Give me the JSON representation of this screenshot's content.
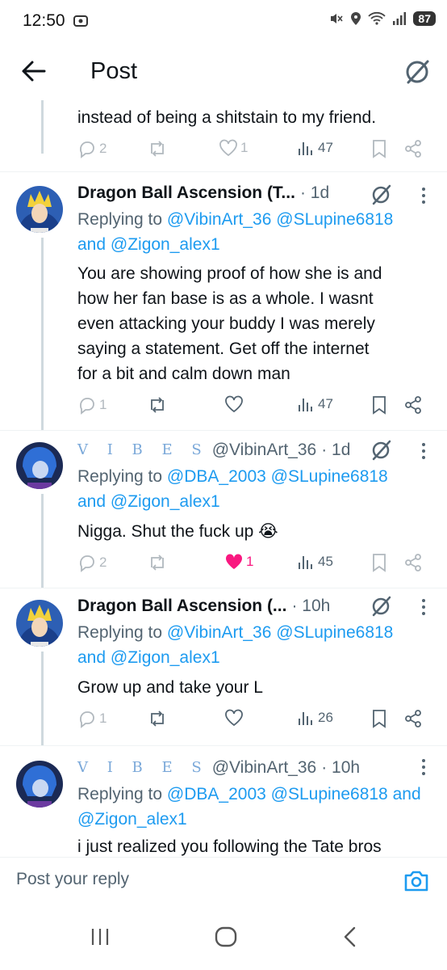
{
  "status": {
    "time": "12:50",
    "battery": "87"
  },
  "header": {
    "title": "Post"
  },
  "posts": [
    {
      "text": "instead of being a shitstain to my friend.",
      "replies": "2",
      "likes": "1",
      "views": "47"
    },
    {
      "author": "Dragon Ball Ascension (T...",
      "time": "· 1d",
      "replying_prefix": "Replying to",
      "replying_line1": "@VibinArt_36 @SLupine6818",
      "replying_and": "and",
      "replying_line2": "@Zigon_alex1",
      "text": "You are showing proof of how she is and\nhow her fan base is as a whole. I wasnt\neven attacking your buddy I was merely\nsaying a statement. Get off the internet\nfor a bit and calm down man",
      "replies": "1",
      "views": "47"
    },
    {
      "author": "V I B E S",
      "handle": "@VibinArt_36",
      "time": "· 1d",
      "replying_prefix": "Replying to",
      "replying_line1": "@DBA_2003 @SLupine6818",
      "replying_and": "and",
      "replying_line2": "@Zigon_alex1",
      "text": "Nigga. Shut the fuck up 😭",
      "replies": "2",
      "likes": "1",
      "views": "45"
    },
    {
      "author": "Dragon Ball Ascension (...",
      "time": "· 10h",
      "replying_prefix": "Replying to",
      "replying_line1": "@VibinArt_36 @SLupine6818",
      "replying_and": "and",
      "replying_line2": "@Zigon_alex1",
      "text": "Grow up and take your L",
      "replies": "1",
      "views": "26"
    },
    {
      "author": "V I B E S",
      "handle": "@VibinArt_36",
      "time": "· 10h",
      "replying_prefix": "Replying to",
      "replying_line1": "@DBA_2003 @SLupine6818",
      "replying_and": "and",
      "replying_line2": "@Zigon_alex1",
      "text": "i just realized you following the Tate bros"
    }
  ],
  "composer": {
    "placeholder": "Post your reply"
  },
  "colors": {
    "accent": "#1d9bf0",
    "like": "#f91880",
    "secondary": "#536471"
  }
}
